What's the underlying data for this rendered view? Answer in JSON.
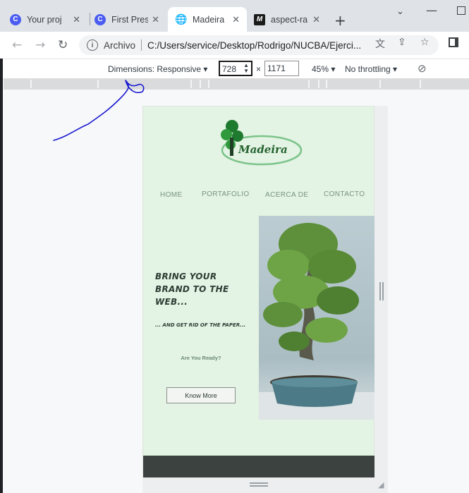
{
  "tabs": [
    {
      "title": "Your proj",
      "icon": "canva-icon",
      "active": false
    },
    {
      "title": "First Pres",
      "icon": "canva-icon",
      "active": false
    },
    {
      "title": "Madeira",
      "icon": "globe-icon",
      "active": true
    },
    {
      "title": "aspect-ra",
      "icon": "mdn-icon",
      "active": false
    }
  ],
  "address": {
    "scheme": "Archivo",
    "url": "C:/Users/service/Desktop/Rodrigo/NUCBA/Ejerci..."
  },
  "devtools": {
    "dimensions_label": "Dimensions: Responsive",
    "width": "728",
    "times": "×",
    "height": "1171",
    "zoom": "45%",
    "throttling": "No throttling"
  },
  "site": {
    "logo_text": "Madeira",
    "nav": [
      "HOME",
      "PORTAFOLIO",
      "ACERCA DE",
      "CONTACTO"
    ],
    "headline": "BRING YOUR BRAND TO THE WEB...",
    "subline": "... AND GET RID OF THE PAPER...",
    "ready": "Are You Ready?",
    "cta": "Know More"
  },
  "colors": {
    "page_bg": "#e3f3e4",
    "brand_green": "#24632e",
    "footer": "#3c423f",
    "annotation": "#1a1ad0"
  }
}
